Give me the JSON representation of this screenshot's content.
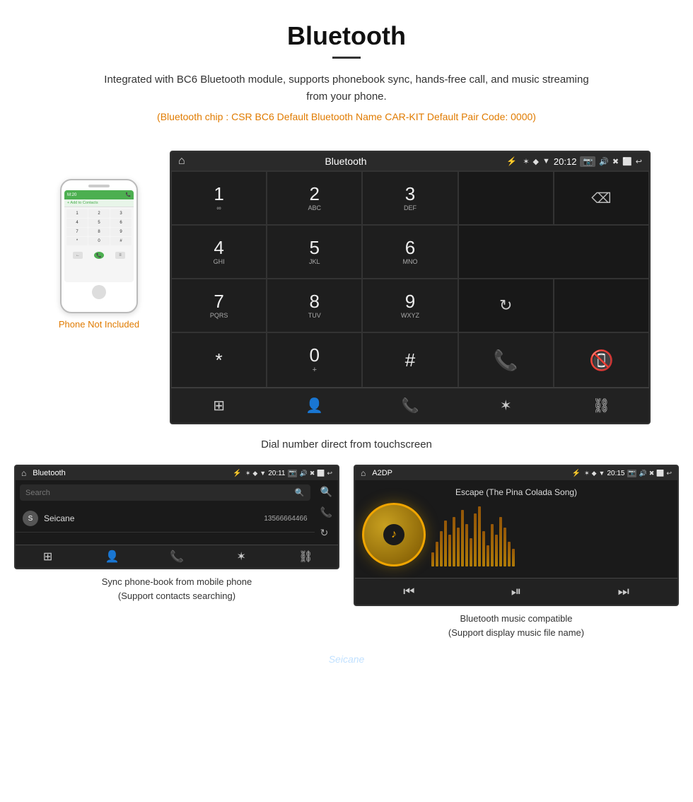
{
  "header": {
    "title": "Bluetooth",
    "description": "Integrated with BC6 Bluetooth module, supports phonebook sync, hands-free call, and music streaming from your phone.",
    "specs": "(Bluetooth chip : CSR BC6    Default Bluetooth Name CAR-KIT    Default Pair Code: 0000)"
  },
  "phone_mockup": {
    "not_included_label": "Phone Not Included",
    "add_contact": "+ Add to Contacts",
    "keys": [
      "1",
      "2",
      "3",
      "4",
      "5",
      "6",
      "7",
      "8",
      "9",
      "*",
      "0",
      "#"
    ]
  },
  "main_screen": {
    "status_bar": {
      "home_icon": "⌂",
      "title": "Bluetooth",
      "usb_icon": "⚡",
      "bt_icon": "⚡",
      "location_icon": "◆",
      "signal_icon": "▼",
      "time": "20:12",
      "camera_icon": "📷",
      "volume_icon": "🔊",
      "close_icon": "✖",
      "window_icon": "⬜",
      "back_icon": "↩"
    },
    "dial_keys": [
      {
        "digit": "1",
        "sub": "∞",
        "col": 1,
        "row": 1
      },
      {
        "digit": "2",
        "sub": "ABC",
        "col": 2,
        "row": 1
      },
      {
        "digit": "3",
        "sub": "DEF",
        "col": 3,
        "row": 1
      },
      {
        "digit": "4",
        "sub": "GHI",
        "col": 1,
        "row": 2
      },
      {
        "digit": "5",
        "sub": "JKL",
        "col": 2,
        "row": 2
      },
      {
        "digit": "6",
        "sub": "MNO",
        "col": 3,
        "row": 2
      },
      {
        "digit": "7",
        "sub": "PQRS",
        "col": 1,
        "row": 3
      },
      {
        "digit": "8",
        "sub": "TUV",
        "col": 2,
        "row": 3
      },
      {
        "digit": "9",
        "sub": "WXYZ",
        "col": 3,
        "row": 3
      },
      {
        "digit": "*",
        "sub": "",
        "col": 1,
        "row": 4
      },
      {
        "digit": "0",
        "sub": "+",
        "col": 2,
        "row": 4
      },
      {
        "digit": "#",
        "sub": "",
        "col": 3,
        "row": 4
      }
    ],
    "bottom_icons": [
      "grid",
      "person",
      "phone",
      "bluetooth",
      "link"
    ],
    "caption": "Dial number direct from touchscreen"
  },
  "phonebook_screen": {
    "status_bar": {
      "title": "Bluetooth",
      "time": "20:11"
    },
    "search_placeholder": "Search",
    "contacts": [
      {
        "letter": "S",
        "name": "Seicane",
        "number": "13566664466"
      }
    ],
    "caption_line1": "Sync phone-book from mobile phone",
    "caption_line2": "(Support contacts searching)"
  },
  "music_screen": {
    "status_bar": {
      "title": "A2DP",
      "time": "20:15"
    },
    "song_name": "Escape (The Pina Colada Song)",
    "caption_line1": "Bluetooth music compatible",
    "caption_line2": "(Support display music file name)"
  },
  "colors": {
    "accent_orange": "#e07b00",
    "screen_bg": "#1a1a1a",
    "status_bar_bg": "#2a2a2a",
    "call_green": "#4CAF50",
    "hangup_red": "#e53935"
  }
}
